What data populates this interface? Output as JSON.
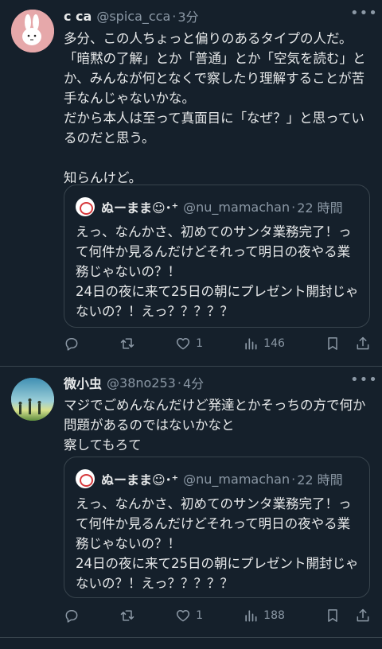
{
  "tweets": [
    {
      "name": "c ca",
      "handle": "@spica_cca",
      "separator": "·",
      "time": "3分",
      "more": "•••",
      "text": "多分、この人ちょっと偏りのあるタイプの人だ。\n「暗黙の了解」とか「普通」とか「空気を読む」とか、みんなが何となくで察したり理解することが苦手なんじゃないかな。\nだから本人は至って真面目に「なぜ？」と思っているのだと思う。\n\n知らんけど。",
      "quote": {
        "name": "ぬーまま☺︎･⁺",
        "handle": "@nu_mamachan",
        "separator": "·",
        "time": "22 時間",
        "text": "えっ、なんかさ、初めてのサンタ業務完了！って何件か見るんだけどそれって明日の夜やる業務じゃないの？！\n24日の夜に来て25日の朝にプレゼント開封じゃないの？！えっ？？？？？"
      },
      "likes": "1",
      "views": "146"
    },
    {
      "name": "微小虫",
      "handle": "@38no253",
      "separator": "·",
      "time": "4分",
      "more": "•••",
      "text": "マジでごめんなんだけど発達とかそっちの方で何か問題があるのではないかなと\n察してもろて",
      "quote": {
        "name": "ぬーまま☺︎･⁺",
        "handle": "@nu_mamachan",
        "separator": "·",
        "time": "22 時間",
        "text": "えっ、なんかさ、初めてのサンタ業務完了！って何件か見るんだけどそれって明日の夜やる業務じゃないの？！\n24日の夜に来て25日の朝にプレゼント開封じゃないの？！えっ？？？？？"
      },
      "likes": "1",
      "views": "188"
    }
  ],
  "icons": [
    "reply-icon",
    "retweet-icon",
    "like-icon",
    "views-icon",
    "bookmark-icon",
    "share-icon"
  ]
}
